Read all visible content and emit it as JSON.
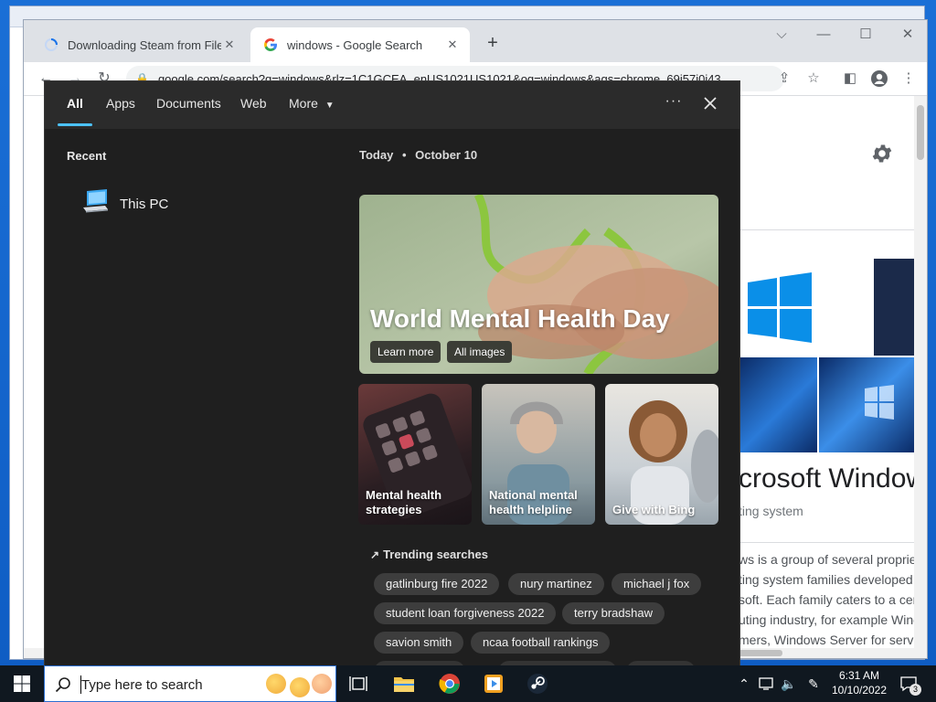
{
  "browser": {
    "tabs": [
      {
        "title": "Downloading Steam from FileHo",
        "active": false
      },
      {
        "title": "windows - Google Search",
        "active": true
      }
    ],
    "url": "google.com/search?q=windows&rlz=1C1GCEA_enUS1021US1021&oq=windows&aqs=chrome..69i57j0i43..."
  },
  "google_page": {
    "kp_title": "crosoft Window",
    "kp_subtitle": "ting system",
    "kp_description": [
      "ws is a group of several proprie",
      "ting system families developed",
      "soft. Each family caters to a cer",
      "uting industry, for example Wind",
      "mers, Windows Server for serv"
    ]
  },
  "search_flyout": {
    "nav": {
      "all": "All",
      "apps": "Apps",
      "documents": "Documents",
      "web": "Web",
      "more": "More"
    },
    "recent": {
      "label": "Recent",
      "items": [
        "This PC"
      ]
    },
    "today": "Today",
    "date": "October 10",
    "hero": {
      "title": "World Mental Health Day",
      "learn_more": "Learn more",
      "all_images": "All images"
    },
    "cards": [
      {
        "caption_line1": "Mental health",
        "caption_line2": "strategies"
      },
      {
        "caption_line1": "National mental",
        "caption_line2": "health helpline"
      },
      {
        "caption_line1": "Give with Bing",
        "caption_line2": ""
      }
    ],
    "trending": {
      "label": "Trending searches",
      "chips": [
        "gatlinburg fire 2022",
        "nury martinez",
        "michael j fox",
        "student loan forgiveness 2022",
        "terry bradshaw",
        "savion smith",
        "ncaa football rankings"
      ]
    }
  },
  "taskbar": {
    "search_placeholder": "Type here to search",
    "time": "6:31 AM",
    "date": "10/10/2022",
    "notification_count": "3"
  },
  "colors": {
    "accent_blue": "#4cc2ff",
    "flyout_bg": "#1f1f1f",
    "taskbar_bg": "#101820"
  }
}
